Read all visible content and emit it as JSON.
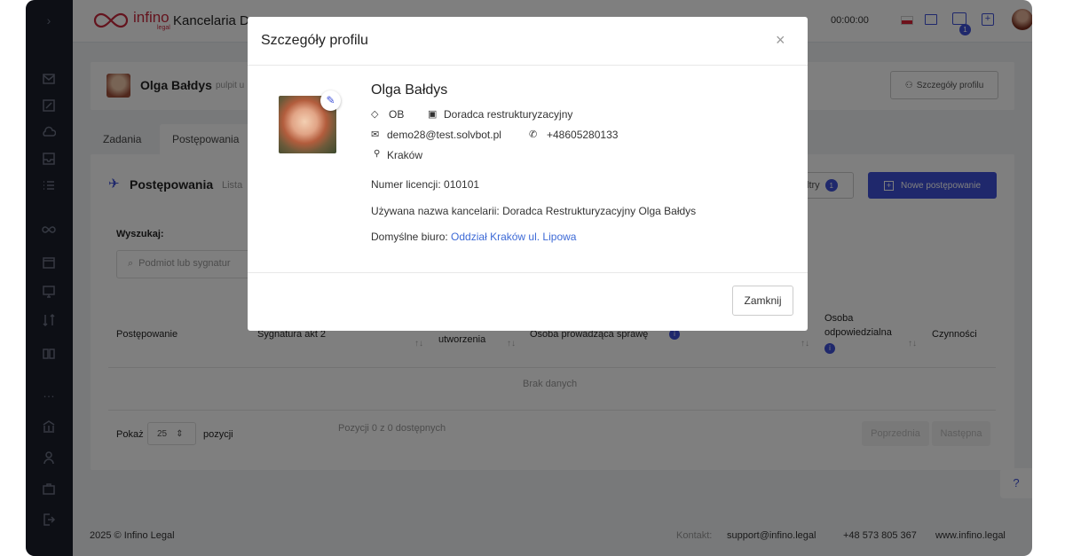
{
  "app": {
    "brand_top": "infino",
    "brand_sub": "legal",
    "title": "Kancelaria D",
    "timer": "00:00:00",
    "notif_count": "1"
  },
  "profile_bar": {
    "name": "Olga Bałdys",
    "sub": "pulpit u",
    "button": "Szczegóły profilu"
  },
  "tabs": [
    "Zadania",
    "Postępowania"
  ],
  "section": {
    "title": "Postępowania",
    "sub": "Lista",
    "filters": "ltry",
    "filters_count": "1",
    "new_button": "Nowe postępowanie"
  },
  "search": {
    "label": "Wyszukaj:",
    "placeholder": "Podmiot lub sygnatur"
  },
  "table": {
    "headers": [
      "Postępowanie",
      "Sygnatura akt 2",
      "utworzenia",
      "Osoba prowadząca sprawę",
      "Osoba odpowiedzialna",
      "Czynności"
    ],
    "empty": "Brak danych"
  },
  "pager": {
    "show": "Pokaż",
    "count": "25",
    "items": "pozycji",
    "info": "Pozycji 0 z 0 dostępnych",
    "prev": "Poprzednia",
    "next": "Następna"
  },
  "footer": {
    "copy": "2025 © Infino Legal",
    "contact_label": "Kontakt:",
    "email": "support@infino.legal",
    "phone": "+48 573 805 367",
    "site": "www.infino.legal"
  },
  "modal": {
    "title": "Szczegóły profilu",
    "name": "Olga Bałdys",
    "initials": "OB",
    "role": "Doradca restrukturyzacyjny",
    "email": "demo28@test.solvbot.pl",
    "phone": "+48605280133",
    "city": "Kraków",
    "license_label": "Numer licencji:",
    "license": "010101",
    "firm_label": "Używana nazwa kancelarii:",
    "firm": "Doradca Restrukturyzacyjny Olga Bałdys",
    "office_label": "Domyślne biuro:",
    "office": "Oddział Kraków ul. Lipowa",
    "close": "Zamknij"
  },
  "colors": {
    "accent": "#3f51d8",
    "sidebar": "#1a1e2b",
    "link": "#3d6ad6"
  }
}
